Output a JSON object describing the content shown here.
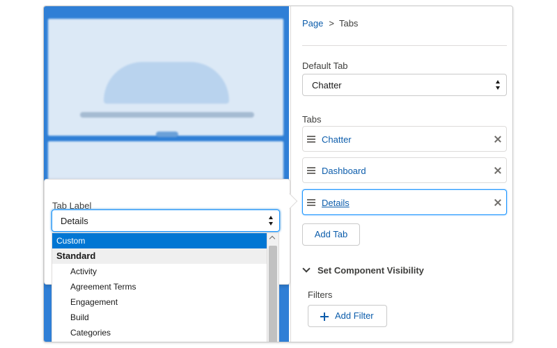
{
  "breadcrumb": {
    "parent": "Page",
    "separator": ">",
    "current": "Tabs"
  },
  "default_tab": {
    "label": "Default Tab",
    "value": "Chatter"
  },
  "tabs": {
    "label": "Tabs",
    "items": [
      {
        "label": "Chatter"
      },
      {
        "label": "Dashboard"
      },
      {
        "label": "Details"
      }
    ],
    "add_label": "Add Tab"
  },
  "visibility": {
    "title": "Set Component Visibility",
    "filters_label": "Filters",
    "add_filter_label": "Add Filter"
  },
  "tab_label_editor": {
    "label": "Tab Label",
    "value": "Details",
    "options": [
      {
        "label": "Custom",
        "kind": "selected"
      },
      {
        "label": "Standard",
        "kind": "group"
      },
      {
        "label": "Activity",
        "kind": "child"
      },
      {
        "label": "Agreement Terms",
        "kind": "child"
      },
      {
        "label": "Engagement",
        "kind": "child"
      },
      {
        "label": "Build",
        "kind": "child"
      },
      {
        "label": "Categories",
        "kind": "child"
      }
    ]
  },
  "colors": {
    "brand": "#0176d3",
    "link": "#0b5cab",
    "border": "#dddbda",
    "canvas": "#2f7fd6"
  },
  "icons": [
    "drag-handle-icon",
    "close-icon",
    "chevron-down-icon",
    "plus-icon",
    "select-arrows-icon",
    "scroll-up-icon"
  ]
}
